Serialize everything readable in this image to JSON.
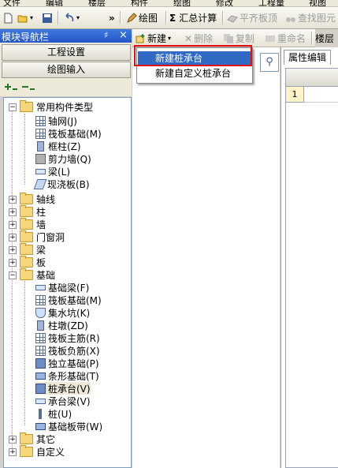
{
  "menubar": {
    "items": [
      "文件",
      "编辑",
      "楼层",
      "构件",
      "绘图",
      "修改",
      "工程量",
      "视图"
    ]
  },
  "toolbar": {
    "draw_label": "绘图",
    "calc_label": "汇总计算",
    "flatten_label": "平齐板顶",
    "find_label": "查找图元",
    "sigma": "Σ",
    "chevron": "»"
  },
  "nav": {
    "title": "模块导航栏",
    "pin": "♯",
    "close": "×",
    "project_settings": "工程设置",
    "drawing_input": "绘图输入"
  },
  "tree": {
    "common_folder": "常用构件类型",
    "common_items": [
      "轴网(J)",
      "筏板基础(M)",
      "框柱(Z)",
      "剪力墙(Q)",
      "梁(L)",
      "现浇板(B)"
    ],
    "folders_a": [
      "轴线",
      "柱",
      "墙",
      "门窗洞",
      "梁",
      "板"
    ],
    "foundation_folder": "基础",
    "foundation_items": [
      "基础梁(F)",
      "筏板基础(M)",
      "集水坑(K)",
      "柱墩(ZD)",
      "筏板主筋(R)",
      "筏板负筋(X)",
      "独立基础(P)",
      "条形基础(T)",
      "桩承台(V)",
      "承台梁(V)",
      "桩(U)",
      "基础板带(W)"
    ],
    "folders_b": [
      "其它",
      "自定义"
    ]
  },
  "midtoolbar": {
    "new_label": "新建",
    "delete_label": "删除",
    "copy_label": "复制",
    "rename_label": "重命名",
    "floor_label": "楼层"
  },
  "popup": {
    "items": [
      "新建桩承台",
      "新建自定义桩承台"
    ],
    "highlighted": "新建桩承台"
  },
  "properties": {
    "tab_label": "属性编辑",
    "row_number": "1"
  },
  "colors": {
    "title_bar": "#2a5fd0",
    "highlight": "#316ac5",
    "annotation_box": "#e01010",
    "row_header": "#fdf3c7"
  }
}
